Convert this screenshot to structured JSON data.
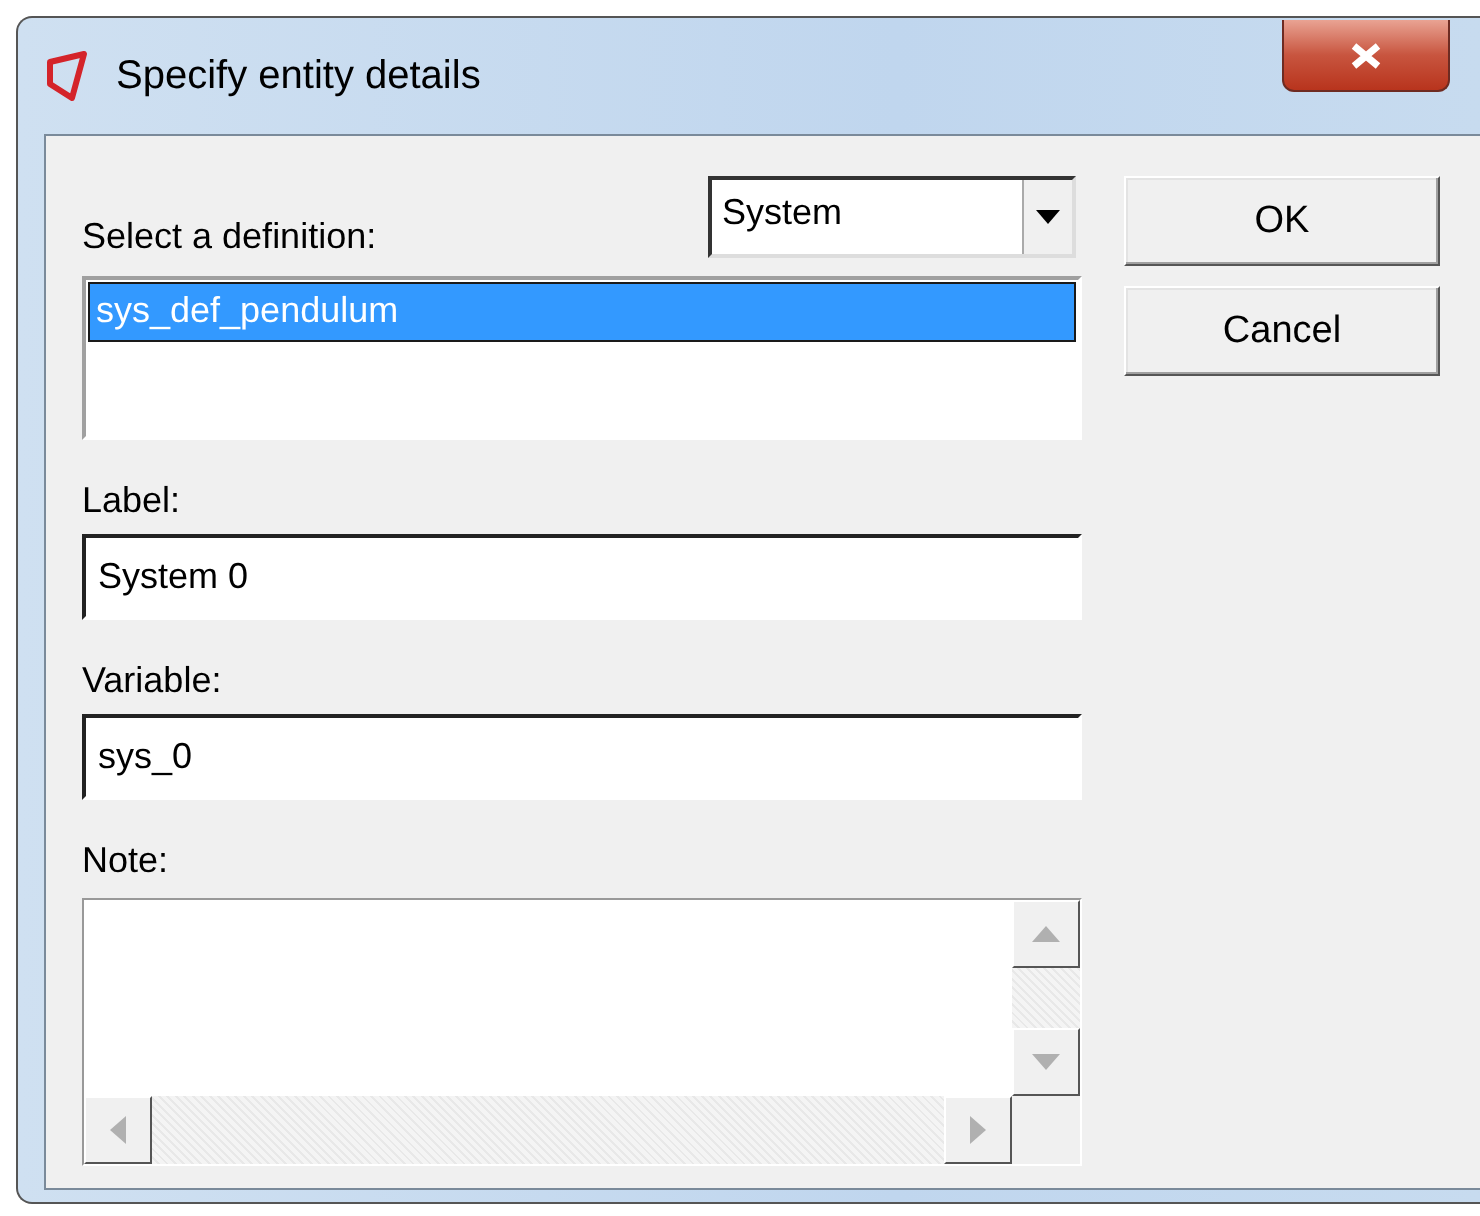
{
  "window": {
    "title": "Specify entity details"
  },
  "definition": {
    "label": "Select a definition:",
    "type": "System",
    "items": [
      {
        "text": "sys_def_pendulum",
        "selected": true
      }
    ]
  },
  "fields": [
    {
      "label": "Label:",
      "value": "System 0"
    },
    {
      "label": "Variable:",
      "value": "sys_0"
    }
  ],
  "note": {
    "label": "Note:"
  },
  "buttons": [
    {
      "label": "OK"
    },
    {
      "label": "Cancel"
    }
  ]
}
